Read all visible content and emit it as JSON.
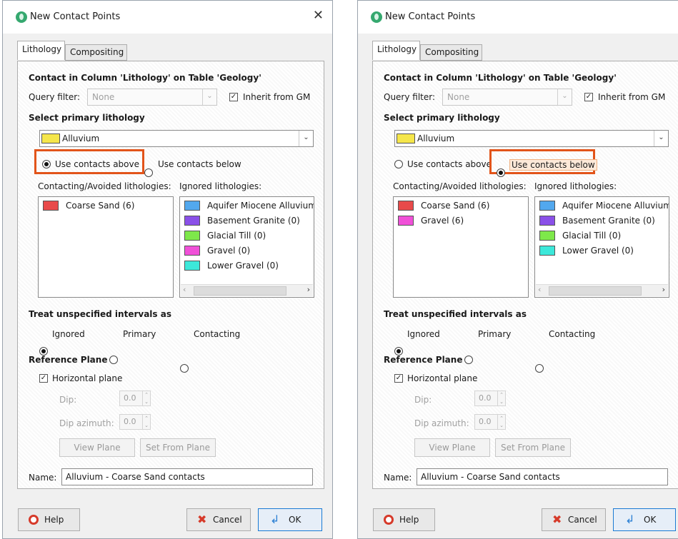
{
  "dialogs": [
    {
      "title": "New Contact Points",
      "tabs": [
        "Lithology",
        "Compositing"
      ],
      "contact_heading": "Contact in Column 'Lithology' on Table 'Geology'",
      "query_filter_label": "Query filter:",
      "query_filter_value": "None",
      "inherit_label": "Inherit from GM",
      "primary_heading": "Select primary lithology",
      "primary_value": "Alluvium",
      "primary_color": "#f5e64a",
      "radio_above": "Use contacts above",
      "radio_below": "Use contacts below",
      "selected": "above",
      "contacting_label": "Contacting/Avoided lithologies:",
      "ignored_label": "Ignored lithologies:",
      "contacting": [
        {
          "name": "Coarse Sand (6)",
          "color": "#e84a4a"
        }
      ],
      "ignored": [
        {
          "name": "Aquifer Miocene Alluvium",
          "color": "#52a8ee"
        },
        {
          "name": "Basement Granite (0)",
          "color": "#8a50e8"
        },
        {
          "name": "Glacial Till (0)",
          "color": "#7ee84a"
        },
        {
          "name": "Gravel (0)",
          "color": "#f050d8"
        },
        {
          "name": "Lower Gravel (0)",
          "color": "#3ce8da"
        }
      ],
      "treat_heading": "Treat unspecified intervals as",
      "treat_options": [
        "Ignored",
        "Primary",
        "Contacting"
      ],
      "ref_heading": "Reference Plane",
      "horizontal_label": "Horizontal plane",
      "dip_label": "Dip:",
      "dip_value": "0.0",
      "azimuth_label": "Dip azimuth:",
      "azimuth_value": "0.0",
      "view_plane": "View Plane",
      "set_from_plane": "Set From Plane",
      "name_label": "Name:",
      "name_value": "Alluvium - Coarse Sand contacts",
      "help": "Help",
      "cancel": "Cancel",
      "ok": "OK"
    },
    {
      "title": "New Contact Points",
      "tabs": [
        "Lithology",
        "Compositing"
      ],
      "contact_heading": "Contact in Column 'Lithology' on Table 'Geology'",
      "query_filter_label": "Query filter:",
      "query_filter_value": "None",
      "inherit_label": "Inherit from GM",
      "primary_heading": "Select primary lithology",
      "primary_value": "Alluvium",
      "primary_color": "#f5e64a",
      "radio_above": "Use contacts above",
      "radio_below": "Use contacts below",
      "selected": "below",
      "contacting_label": "Contacting/Avoided lithologies:",
      "ignored_label": "Ignored lithologies:",
      "contacting": [
        {
          "name": "Coarse Sand (6)",
          "color": "#e84a4a"
        },
        {
          "name": "Gravel (6)",
          "color": "#f050d8"
        }
      ],
      "ignored": [
        {
          "name": "Aquifer Miocene Alluvium",
          "color": "#52a8ee"
        },
        {
          "name": "Basement Granite (0)",
          "color": "#8a50e8"
        },
        {
          "name": "Glacial Till (0)",
          "color": "#7ee84a"
        },
        {
          "name": "Lower Gravel (0)",
          "color": "#3ce8da"
        }
      ],
      "treat_heading": "Treat unspecified intervals as",
      "treat_options": [
        "Ignored",
        "Primary",
        "Contacting"
      ],
      "ref_heading": "Reference Plane",
      "horizontal_label": "Horizontal plane",
      "dip_label": "Dip:",
      "dip_value": "0.0",
      "azimuth_label": "Dip azimuth:",
      "azimuth_value": "0.0",
      "view_plane": "View Plane",
      "set_from_plane": "Set From Plane",
      "name_label": "Name:",
      "name_value": "Alluvium - Coarse Sand contacts",
      "help": "Help",
      "cancel": "Cancel",
      "ok": "OK"
    }
  ],
  "colors": {
    "highlight": "#e2541a",
    "ok_border": "#1a7ad4"
  }
}
